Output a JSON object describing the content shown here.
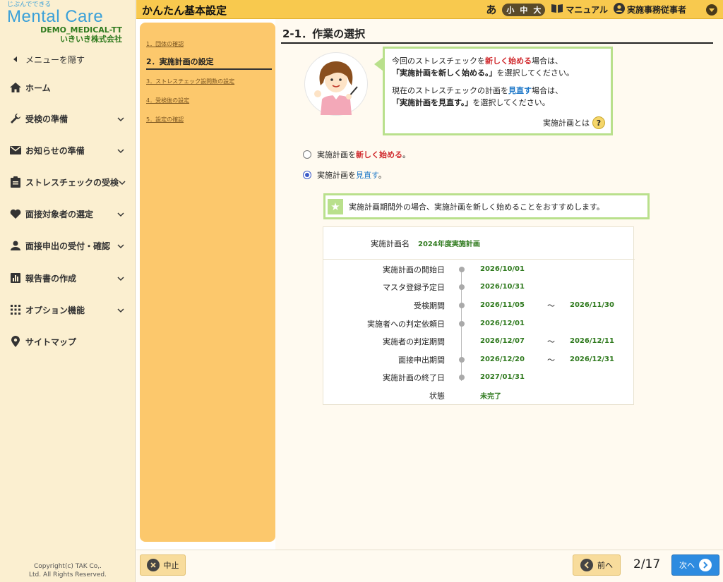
{
  "logo": {
    "tagline": "じぶんでできる",
    "name": "Mental Care"
  },
  "org": {
    "code": "DEMO_MEDICAL-TT",
    "company": "いきいき株式会社"
  },
  "sidebar": {
    "hide_menu": "メニューを隠す",
    "items": [
      {
        "label": "ホーム",
        "icon": "home-icon"
      },
      {
        "label": "受検の準備",
        "icon": "wrench-icon"
      },
      {
        "label": "お知らせの準備",
        "icon": "mail-icon"
      },
      {
        "label": "ストレスチェックの受検",
        "icon": "clipboard-icon"
      },
      {
        "label": "面接対象者の選定",
        "icon": "heart-icon"
      },
      {
        "label": "面接申出の受付・確認",
        "icon": "person-icon"
      },
      {
        "label": "報告書の作成",
        "icon": "chart-icon"
      },
      {
        "label": "オプション機能",
        "icon": "grid-icon"
      },
      {
        "label": "サイトマップ",
        "icon": "pin-icon"
      }
    ],
    "copyright": "Copyright(c) TAK Co,.",
    "rights": "Ltd. All Rights Reserved."
  },
  "header": {
    "title": "かんたん基本設定",
    "font_icon": "あ",
    "font_sizes": [
      "小",
      "中",
      "大"
    ],
    "manual": "マニュアル",
    "user": "実施事務従事者"
  },
  "steps": [
    {
      "label": "1．団体の確認"
    },
    {
      "label": "2．実施計画の設定"
    },
    {
      "label": "3．ストレスチェック設問数の設定"
    },
    {
      "label": "4．受検後の設定"
    },
    {
      "label": "5．設定の確認"
    }
  ],
  "main": {
    "heading": "2-1．作業の選択",
    "bubble": {
      "l1a": "今回のストレスチェックを",
      "l1b": "新しく始める",
      "l1c": "場合は、",
      "l2a": "「実施計画を新しく始める。」",
      "l2b": "を選択してください。",
      "l3a": "現在のストレスチェックの計画を",
      "l3b": "見直す",
      "l3c": "場合は、",
      "l4a": "「実施計画を見直す。」",
      "l4b": "を選択してください。",
      "help": "実施計画とは",
      "help_icon": "?"
    },
    "radio1": {
      "a": "実施計画を",
      "b": "新しく始める",
      "c": "。"
    },
    "radio2": {
      "a": "実施計画を",
      "b": "見直す",
      "c": "。"
    },
    "recommend": "実施計画期間外の場合、実施計画を新しく始めることをおすすめします。",
    "plan": {
      "name_label": "実施計画名",
      "name_value": "2024年度実施計画",
      "rows": [
        {
          "label": "実施計画の開始日",
          "date1": "2026/10/01",
          "sep": "",
          "date2": ""
        },
        {
          "label": "マスタ登録予定日",
          "date1": "2026/10/31",
          "sep": "",
          "date2": ""
        },
        {
          "label": "受検期間",
          "date1": "2026/11/05",
          "sep": "～",
          "date2": "2026/11/30"
        },
        {
          "label": "実施者への判定依頼日",
          "date1": "2026/12/01",
          "sep": "",
          "date2": ""
        },
        {
          "label": "実施者の判定期間",
          "date1": "2026/12/07",
          "sep": "～",
          "date2": "2026/12/11"
        },
        {
          "label": "面接申出期間",
          "date1": "2026/12/20",
          "sep": "～",
          "date2": "2026/12/31"
        },
        {
          "label": "実施計画の終了日",
          "date1": "2027/01/31",
          "sep": "",
          "date2": ""
        },
        {
          "label": "状態",
          "date1": "未完了",
          "sep": "",
          "date2": ""
        }
      ]
    }
  },
  "footer": {
    "stop": "中止",
    "prev": "前へ",
    "page": "2/17",
    "next": "次へ"
  },
  "colors": {
    "header": "#f8c94e",
    "sidebar": "#fbefd0",
    "steps": "#fcc86c",
    "accent_green": "#b9e08c",
    "next_button": "#2d8be0",
    "red_text": "#d0282c",
    "blue_text": "#1e78c8"
  }
}
